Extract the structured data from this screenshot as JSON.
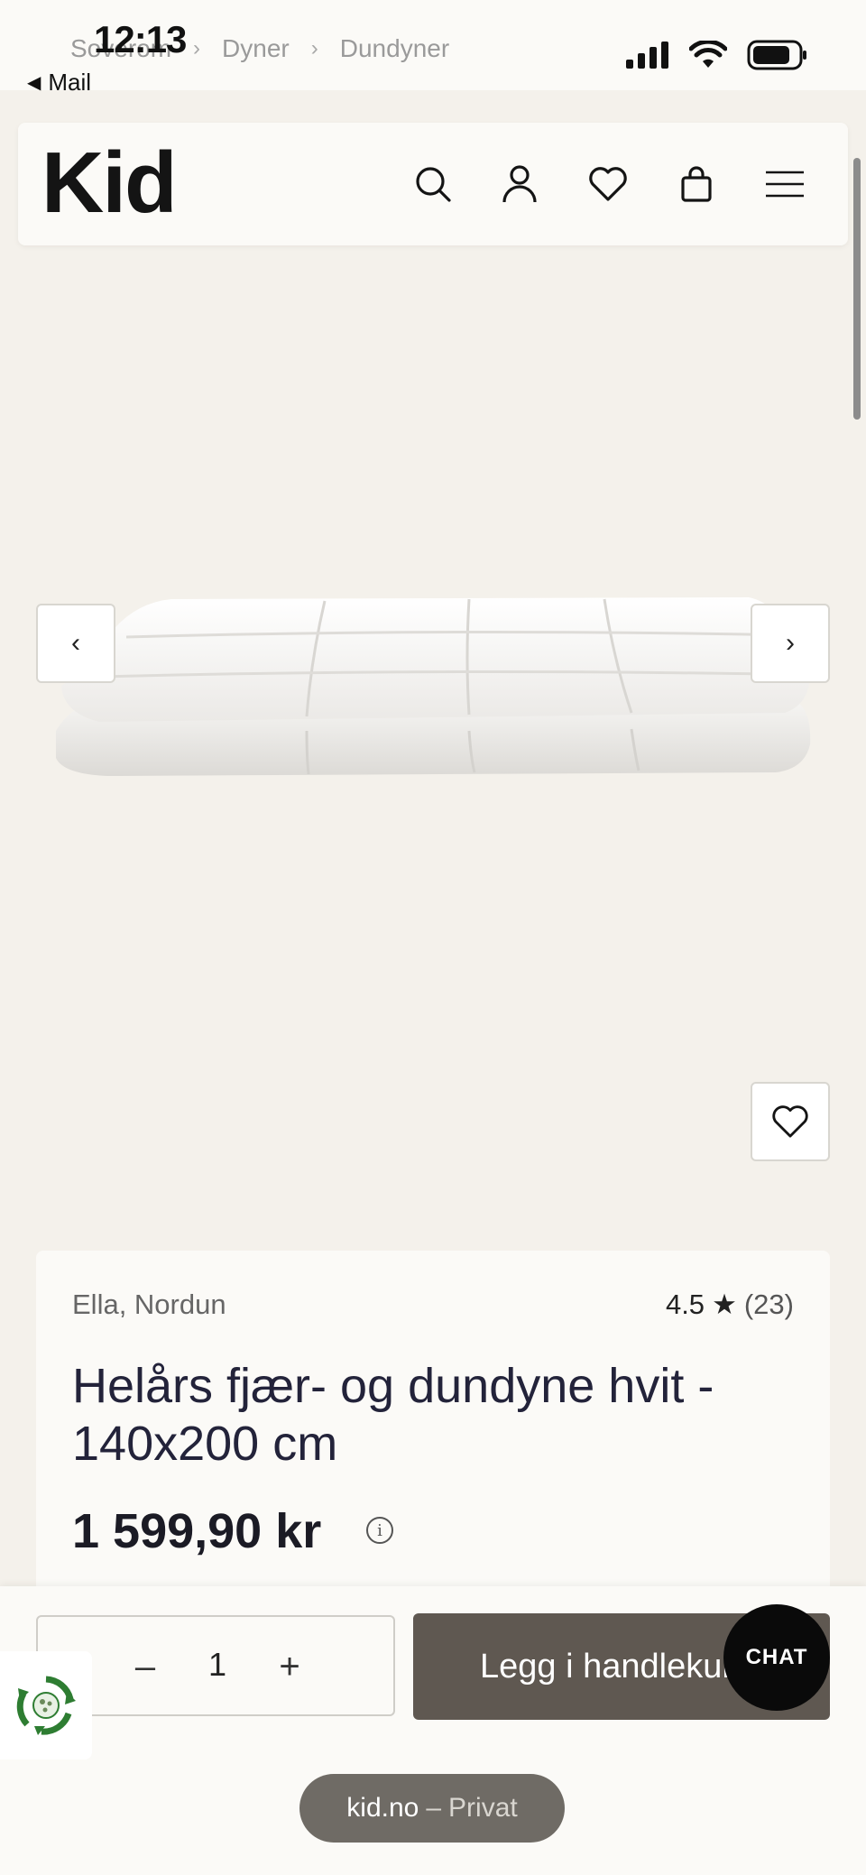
{
  "status_bar": {
    "time": "12:13",
    "back_app": "Mail"
  },
  "breadcrumb": {
    "items": [
      "Soverom",
      "Dyner",
      "Dundyner"
    ],
    "separator": "›"
  },
  "header": {
    "logo": "Kid",
    "icons": [
      "search-icon",
      "account-icon",
      "wishlist-icon",
      "cart-icon",
      "menu-icon"
    ]
  },
  "gallery": {
    "prev_label": "‹",
    "next_label": "›"
  },
  "product": {
    "brand": "Ella, Nordun",
    "rating": "4.5",
    "rating_star": "★",
    "review_count": "(23)",
    "title": "Helårs fjær- og dundyne hvit - 140x200 cm",
    "price": "1 599,90 kr",
    "info_symbol": "i"
  },
  "purchase": {
    "quantity": "1",
    "minus": "–",
    "plus": "+",
    "add_to_cart": "Legg i handlekurv",
    "chat": "CHAT"
  },
  "browser": {
    "domain": "kid.no",
    "separator": "–",
    "mode": "Privat"
  },
  "colors": {
    "background": "#f4f1eb",
    "card": "#fbfaf7",
    "add_button": "#5f5851",
    "chat_button": "#0a0a0a",
    "eco_green": "#2e7d32"
  }
}
